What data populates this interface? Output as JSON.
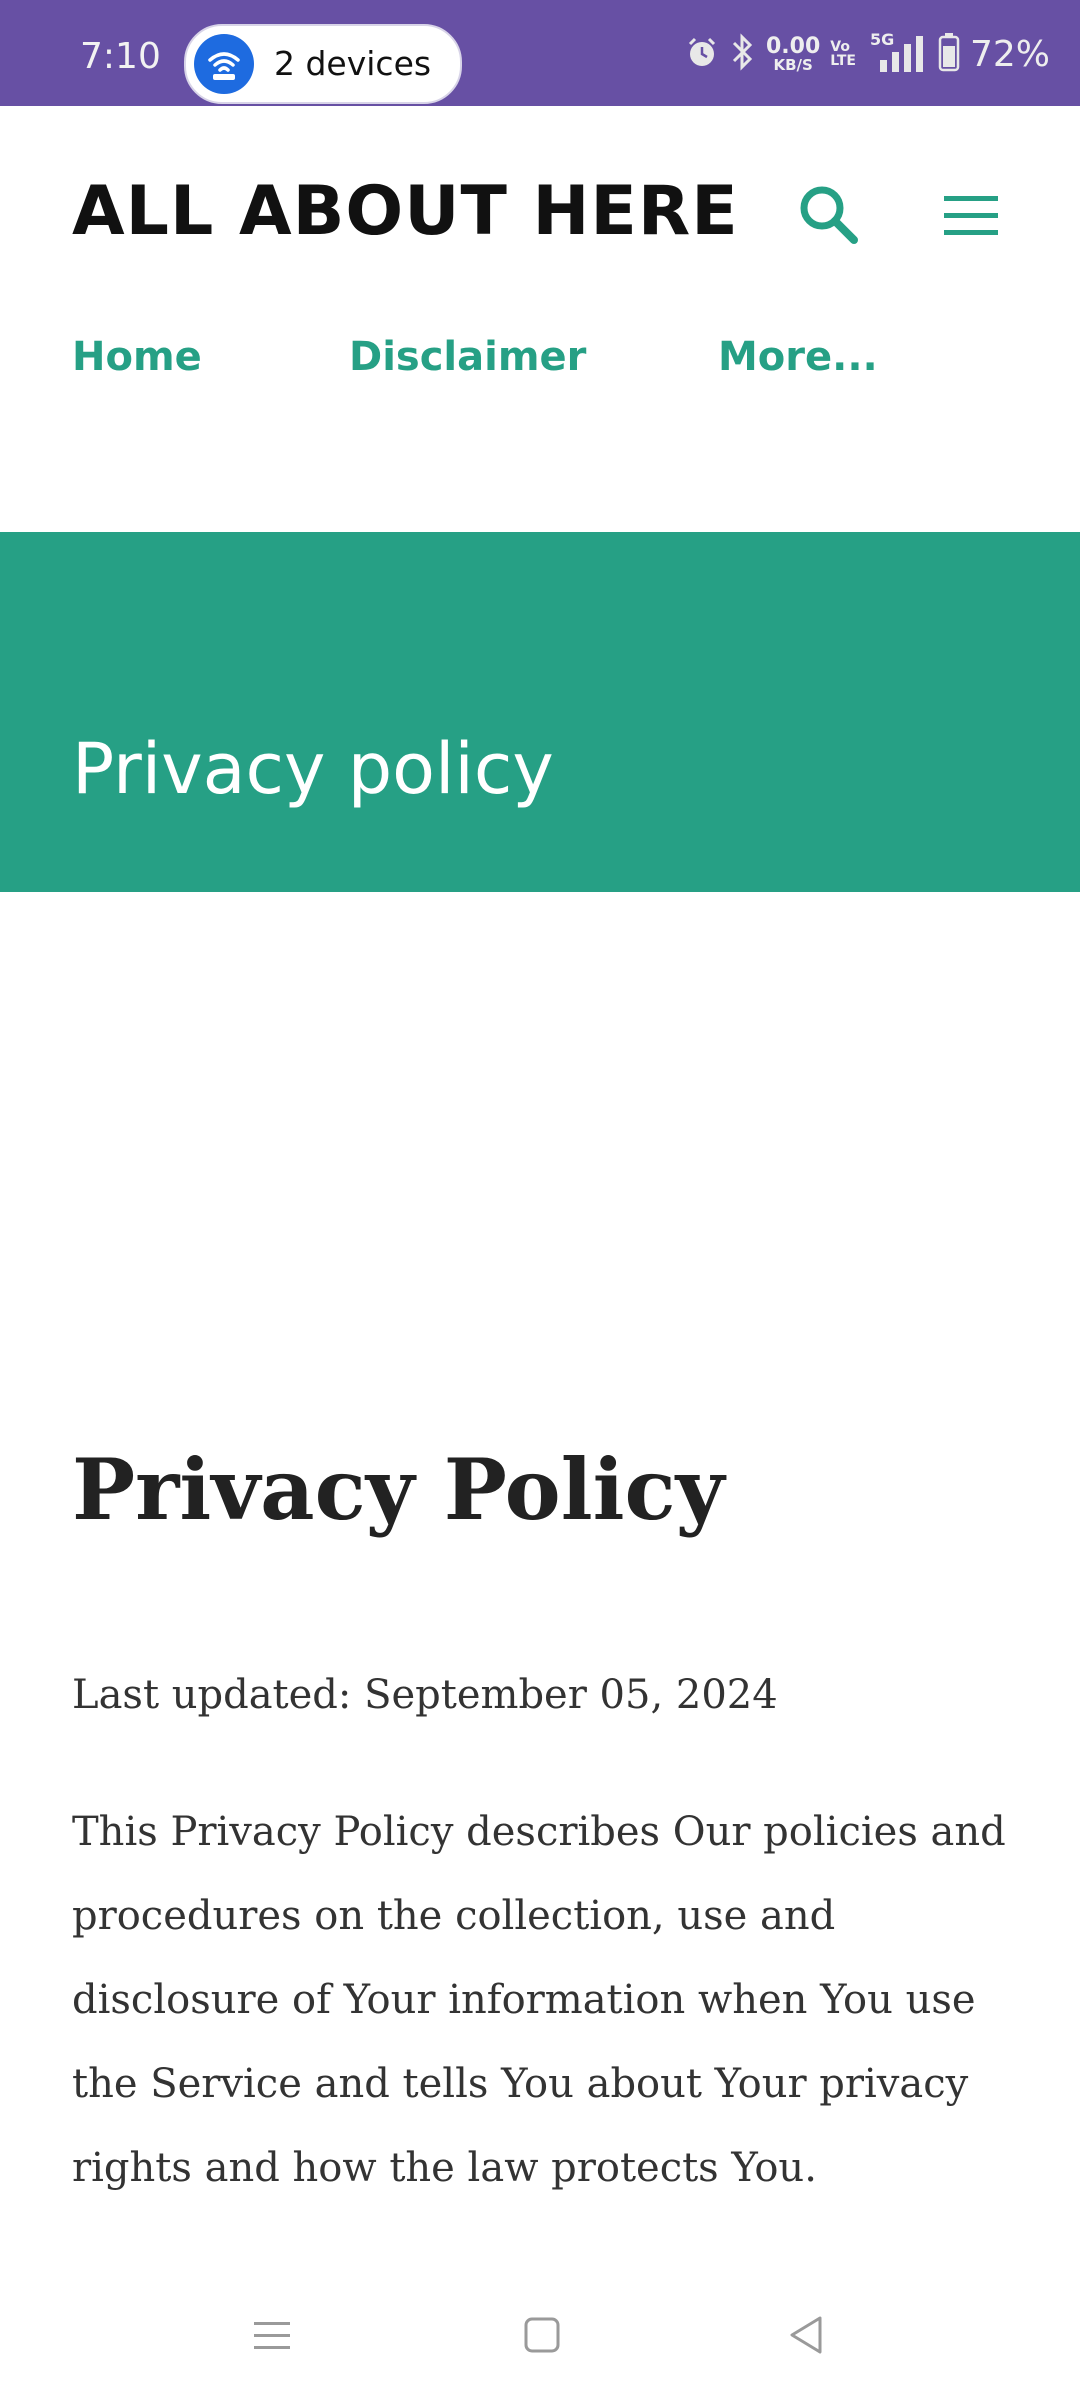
{
  "status_bar": {
    "time": "7:10",
    "hotspot_label": "2 devices",
    "net_speed_value": "0.00",
    "net_speed_unit": "KB/S",
    "volte_top": "Vo",
    "volte_bottom": "LTE",
    "network_type": "5G",
    "battery_percent": "72%",
    "bar_color": "#6750A4"
  },
  "header": {
    "site_title": "ALL ABOUT HERE",
    "accent_color": "#26A085",
    "nav": [
      {
        "label": "Home"
      },
      {
        "label": "Disclaimer"
      },
      {
        "label": "More..."
      }
    ]
  },
  "banner": {
    "title": "Privacy policy"
  },
  "post": {
    "title": "Privacy Policy",
    "last_updated": "Last updated: September 05, 2024",
    "intro": "This Privacy Policy describes Our policies and procedures on the collection, use and disclosure of Your information when You use the Service and tells You about Your privacy rights and how the law protects You."
  },
  "icons": {
    "search": "search-icon",
    "menu": "hamburger-menu-icon",
    "recents": "recents-icon",
    "home": "home-square-icon",
    "back": "back-triangle-icon"
  }
}
